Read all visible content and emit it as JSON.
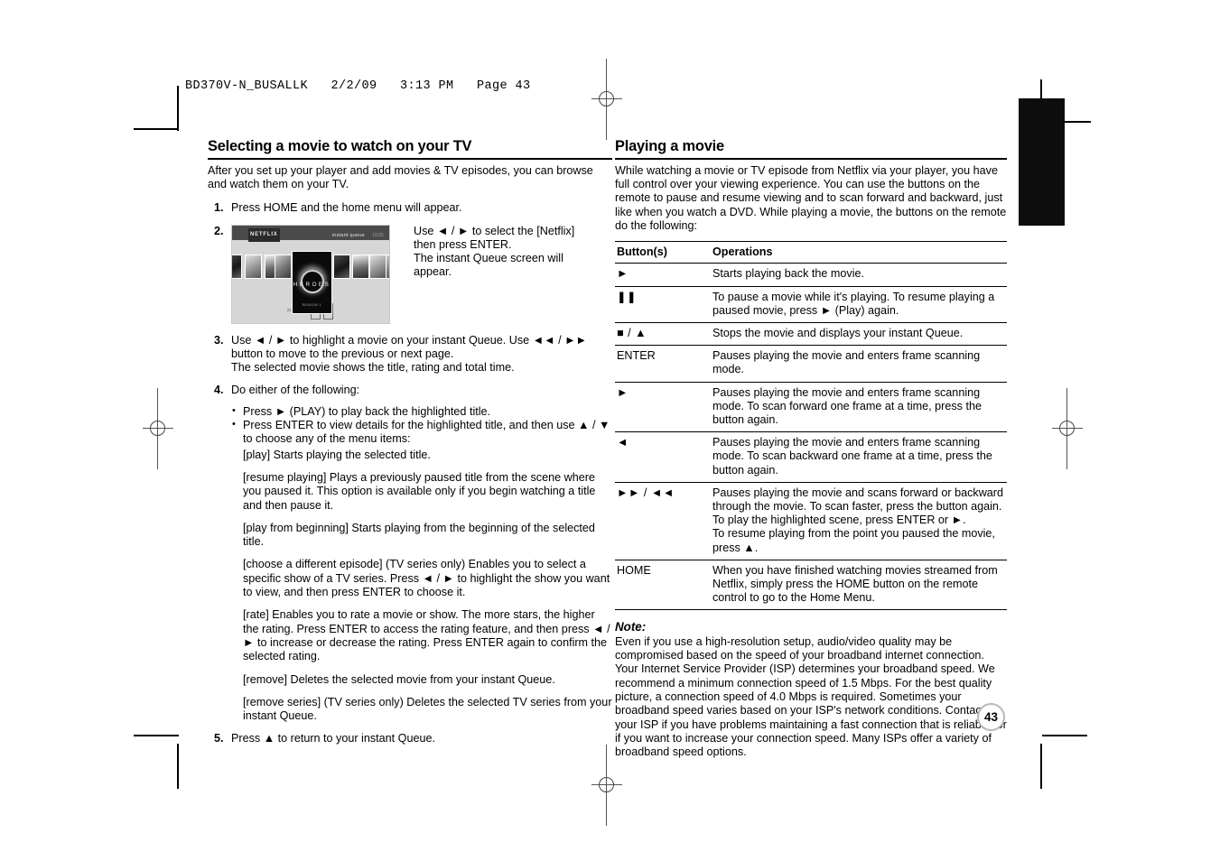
{
  "slug": "BD370V-N_BUSALLK   2/2/09   3:13 PM   Page 43",
  "page_number": "43",
  "left_column": {
    "title": "Selecting a movie to watch on your TV",
    "intro": "After you set up your player and add movies & TV episodes, you can browse and watch them on your TV.",
    "steps": [
      {
        "num": "1.",
        "text": "Press HOME and the home menu will appear."
      },
      {
        "num": "2.",
        "text": "Use ◄ / ► to select the [Netflix] then press ENTER.\nThe instant Queue screen will appear."
      },
      {
        "num": "3.",
        "text": "Use ◄ / ► to highlight a movie on your instant Queue. Use ◄◄ / ►► button to move to the previous or next page.\nThe selected movie shows the title, rating and total time."
      },
      {
        "num": "4.",
        "text": "Do either of the following:"
      },
      {
        "num": "5.",
        "text": "Press ▲ to return to your instant Queue."
      }
    ],
    "step2_lines": [
      "Use ◄ / ► to select the [Netflix]",
      "then press ENTER.",
      "The instant Queue screen will",
      "appear."
    ],
    "step3_lines": [
      "Use ◄ / ► to highlight a movie on your instant Queue. Use ◄◄ / ►►",
      "button to move to the previous or next page.",
      "The selected movie shows the title, rating and total time."
    ],
    "bullets": [
      "Press ► (PLAY) to play back the highlighted title.",
      "Press ENTER to view details for the highlighted title, and then use ▲ / ▼ to choose any of the menu items:"
    ],
    "menu_items": [
      "[play] Starts playing the selected title.",
      "[resume playing] Plays a previously paused title from the scene where you paused it. This option is available only if you begin watching a title and then pause it.",
      "[play from beginning] Starts playing from the beginning of the selected title.",
      "[choose a different episode] (TV series only) Enables you to select a specific show of a TV series. Press ◄ / ► to highlight the show you want to view, and then press ENTER to choose it.",
      "[rate] Enables you to rate a movie or show. The more stars, the higher the rating. Press ENTER to access the rating feature, and then press ◄ / ► to increase or decrease the rating. Press ENTER again to confirm the selected rating.",
      "[remove] Deletes the selected movie from your instant Queue.",
      "[remove series] (TV series only) Deletes the selected TV series from your instant Queue."
    ],
    "screenshot": {
      "logo": "NETFLIX",
      "queue_label": "instant queue",
      "queue_count": "15|35",
      "hero_title": "HEROES",
      "hero_sub": "SEASON\n1",
      "caption": "Heroes Season 1",
      "meta": "21 episodes",
      "chips": [
        "HD",
        "CC"
      ]
    }
  },
  "right_column": {
    "title": "Playing a movie",
    "intro": "While watching a movie or TV episode from Netflix via your player, you have full control over your viewing experience. You can use the buttons on the remote to pause and resume viewing and to scan forward and backward, just like when you watch a DVD. While playing a movie, the buttons on the remote do the following:",
    "table": {
      "headers": [
        "Button(s)",
        "Operations"
      ],
      "rows": [
        {
          "button": "►",
          "operation": "Starts playing back the movie."
        },
        {
          "button": "❚❚",
          "operation": "To pause a movie while it's playing. To resume playing a paused movie, press ► (Play) again."
        },
        {
          "button": "■ / ▲",
          "operation": "Stops the movie and displays your instant Queue."
        },
        {
          "button": "ENTER",
          "operation": "Pauses playing the movie and enters frame scanning mode."
        },
        {
          "button": "►",
          "operation": "Pauses playing the movie and enters frame scanning mode. To scan forward one frame at a time, press the button again."
        },
        {
          "button": "◄",
          "operation": "Pauses playing the movie and enters frame scanning mode. To scan backward one frame at a time, press the button again."
        },
        {
          "button": "►► / ◄◄",
          "operation": "Pauses playing the movie and scans forward or backward through the movie. To scan faster, press the button again.\nTo play the highlighted scene, press ENTER or ►.\nTo resume playing from the point you paused the movie, press ▲."
        },
        {
          "button": "HOME",
          "operation": "When you have finished watching movies streamed from Netflix, simply press the HOME button on the remote control to go to the Home Menu."
        }
      ]
    },
    "note_label": "Note:",
    "note_body": "Even if you use a high-resolution setup, audio/video quality may be compromised based on the speed of your broadband internet connection. Your Internet Service Provider (ISP) determines your broadband speed. We recommend a minimum connection speed of 1.5 Mbps. For the best quality picture, a connection speed of 4.0 Mbps is required. Sometimes your broadband speed varies based on your ISP's network conditions. Contact your ISP if you have problems maintaining a fast connection that is reliable, or if you want to increase your connection speed. Many ISPs offer a variety of broadband speed options."
  }
}
